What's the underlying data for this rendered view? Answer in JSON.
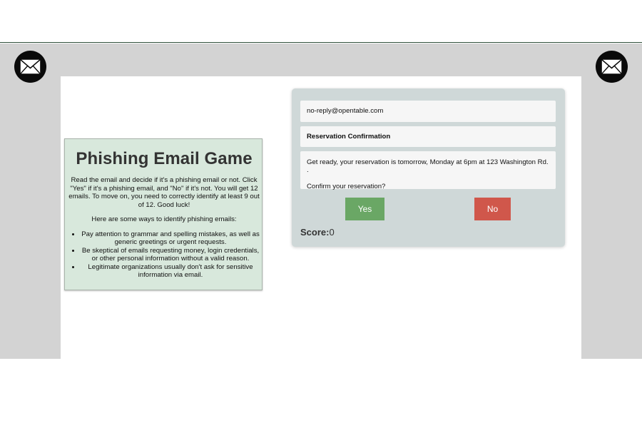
{
  "game": {
    "title": "Phishing Email Game",
    "instructions": "Read the email and decide if it's a phishing email or not. Click \"Yes\" if it's a phishing email, and \"No\" if it's not. You will get 12 emails. To move on, you need to correctly identify at least 9 out of 12. Good luck!",
    "tips_intro": "Here are some ways to identify phishing emails:",
    "tips": [
      "Pay attention to grammar and spelling mistakes, as well as generic greetings or urgent requests.",
      "Be skeptical of emails requesting money, login credentials, or other personal information without a valid reason.",
      "Legitimate organizations usually don't ask for sensitive information via email."
    ]
  },
  "email": {
    "sender": "no-reply@opentable.com",
    "subject": "Reservation Confirmation",
    "body_line1": "Get ready, your reservation is tomorrow, Monday at 6pm at 123 Washington Rd. .",
    "body_line2": "Confirm your reservation?"
  },
  "buttons": {
    "yes_label": "Yes",
    "no_label": "No"
  },
  "score": {
    "label": "Score:",
    "value": "0"
  },
  "icons": {
    "left": "envelope-icon",
    "right": "envelope-icon"
  },
  "colors": {
    "yes": "#6aa765",
    "no": "#d0574b",
    "panel": "#d8e8dc",
    "card": "#cfd8d8",
    "background": "#d3d3d3"
  }
}
